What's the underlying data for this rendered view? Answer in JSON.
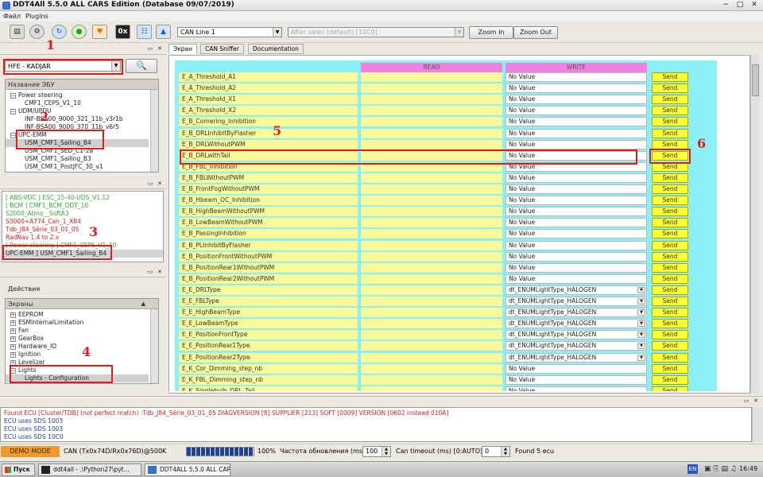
{
  "window": {
    "title": "DDT4All 5.5.0 ALL CARS Edition (Database 09/07/2019)",
    "minimize": "−",
    "maximize": "□",
    "close": "✕"
  },
  "menu": {
    "file": "Файл",
    "plugins": "Plugins"
  },
  "toolbar": {
    "icons": [
      "terminal-icon",
      "chip-icon",
      "refresh-icon",
      "globe-icon",
      "heart-icon",
      "hex-icon",
      "network-icon",
      "valve-icon"
    ],
    "hex_label": "0x",
    "can_line": "CAN Line 1",
    "session": "After sales (default) [10C0]",
    "zoom_in": "Zoom In",
    "zoom_out": "Zoom Out"
  },
  "vehicle": {
    "selected": "HFE - KADJAR",
    "search_icon": "magnifier-icon"
  },
  "ecu_tree": {
    "header": "Название ЭБУ",
    "rows": [
      {
        "text": "Power steering",
        "indent": 1,
        "toggle": "−",
        "selected": false
      },
      {
        "text": "CMF1_CEPS_V1_10",
        "indent": 2,
        "toggle": "",
        "selected": false
      },
      {
        "text": "UDM/UPDU",
        "indent": 1,
        "toggle": "−",
        "selected": false
      },
      {
        "text": "INF-BSA00_9000_321_11b_v3r1b",
        "indent": 2,
        "toggle": "",
        "selected": false
      },
      {
        "text": "INF-BSA00_9000_370_11b_v6r5",
        "indent": 2,
        "toggle": "",
        "selected": false
      },
      {
        "text": "UPC-EMM",
        "indent": 1,
        "toggle": "−",
        "selected": false
      },
      {
        "text": "USM_CMF1_Sailing_B4",
        "indent": 2,
        "toggle": "",
        "selected": true
      },
      {
        "text": "USM_CMF1_SED_C1-2a",
        "indent": 2,
        "toggle": "",
        "selected": false
      },
      {
        "text": "USM_CMF1_Sailing_B3",
        "indent": 2,
        "toggle": "",
        "selected": false
      },
      {
        "text": "USM_CMF1_PostJFC_30_v1",
        "indent": 2,
        "toggle": "",
        "selected": false
      }
    ]
  },
  "found_ecus": [
    {
      "text": "[ ABS-VDC ] ESC_15-40-UDS_V1.12",
      "color": "#33aa33"
    },
    {
      "text": "[ BCM ] CMF1_BCM_DDT_10",
      "color": "#33aa33"
    },
    {
      "text": "S2000_Atmo__SoftA3",
      "color": "#33aa33"
    },
    {
      "text": "S3000+A774_Can_1_X84",
      "color": "#cc2222"
    },
    {
      "text": "Tdb_J84_Série_03_01_05",
      "color": "#cc2222"
    },
    {
      "text": "RadNav 1.4 to 2.x",
      "color": "#cc2222"
    },
    {
      "text": "[ Power steering ] CMF1_CEPS_V1_10",
      "color": "#33aa33"
    },
    {
      "text": "UPC-EMM ] USM_CMF1_Sailing_B4",
      "color": "#222222"
    }
  ],
  "actions": {
    "title": "Действия",
    "header": "Экраны",
    "rows": [
      {
        "text": "EEPROM",
        "indent": 1,
        "toggle": "+",
        "selected": false
      },
      {
        "text": "ESMInternalLimitation",
        "indent": 1,
        "toggle": "+",
        "selected": false
      },
      {
        "text": "Fan",
        "indent": 1,
        "toggle": "+",
        "selected": false
      },
      {
        "text": "GearBox",
        "indent": 1,
        "toggle": "+",
        "selected": false
      },
      {
        "text": "Hardware_IO",
        "indent": 1,
        "toggle": "+",
        "selected": false
      },
      {
        "text": "Ignition",
        "indent": 1,
        "toggle": "+",
        "selected": false
      },
      {
        "text": "Levelizer",
        "indent": 1,
        "toggle": "+",
        "selected": false
      },
      {
        "text": "Lights",
        "indent": 1,
        "toggle": "−",
        "selected": false
      },
      {
        "text": "Lights - Configuration",
        "indent": 2,
        "toggle": "",
        "selected": true
      }
    ]
  },
  "tabs": [
    {
      "label": "Экран",
      "active": true
    },
    {
      "label": "CAN Sniffer",
      "active": false
    },
    {
      "label": "Documentation",
      "active": false
    }
  ],
  "columns": {
    "read": "READ",
    "write": "WRITE"
  },
  "send_label": "Send",
  "params": [
    {
      "name": "E_A_Threshold_A1",
      "write": "No Value",
      "dropdown": false
    },
    {
      "name": "E_A_Threshold_A2",
      "write": "No Value",
      "dropdown": false
    },
    {
      "name": "E_A_Threshold_X1",
      "write": "No Value",
      "dropdown": false
    },
    {
      "name": "E_A_Threshold_X2",
      "write": "No Value",
      "dropdown": false
    },
    {
      "name": "E_B_Cornering_Inhibition",
      "write": "No Value",
      "dropdown": false
    },
    {
      "name": "E_B_DRLInhibitByFlasher",
      "write": "No Value",
      "dropdown": false
    },
    {
      "name": "E_B_DRLWithoutPWM",
      "write": "No Value",
      "dropdown": false
    },
    {
      "name": "E_B_DRLwithTail",
      "write": "No Value",
      "dropdown": false
    },
    {
      "name": "E_B_FBL_Inhibition",
      "write": "No Value",
      "dropdown": false
    },
    {
      "name": "E_B_FBLWithoutPWM",
      "write": "No Value",
      "dropdown": false
    },
    {
      "name": "E_B_FrontFogWithoutPWM",
      "write": "No Value",
      "dropdown": false
    },
    {
      "name": "E_B_Hbeam_OC_Inhibition",
      "write": "No Value",
      "dropdown": false
    },
    {
      "name": "E_B_HighBeamWithoutPWM",
      "write": "No Value",
      "dropdown": false
    },
    {
      "name": "E_B_LowBeamWithoutPWM",
      "write": "No Value",
      "dropdown": false
    },
    {
      "name": "E_B_PassingInhibition",
      "write": "No Value",
      "dropdown": false
    },
    {
      "name": "E_B_PLInhibitByFlasher",
      "write": "No Value",
      "dropdown": false
    },
    {
      "name": "E_B_PositionFrontWithoutPWM",
      "write": "No Value",
      "dropdown": false
    },
    {
      "name": "E_B_PositionRear1WithoutPWM",
      "write": "No Value",
      "dropdown": false
    },
    {
      "name": "E_B_PositionRear2WithoutPWM",
      "write": "No Value",
      "dropdown": false
    },
    {
      "name": "E_E_DRLType",
      "write": "dt_ENUMLightType_HALOGEN",
      "dropdown": true
    },
    {
      "name": "E_E_FBLType",
      "write": "dt_ENUMLightType_HALOGEN",
      "dropdown": true
    },
    {
      "name": "E_E_HighBeamType",
      "write": "dt_ENUMLightType_HALOGEN",
      "dropdown": true
    },
    {
      "name": "E_E_LowBeamType",
      "write": "dt_ENUMLightType_HALOGEN",
      "dropdown": true
    },
    {
      "name": "E_E_PositionFrontType",
      "write": "dt_ENUMLightType_HALOGEN",
      "dropdown": true
    },
    {
      "name": "E_E_PositionRear1Type",
      "write": "dt_ENUMLightType_HALOGEN",
      "dropdown": true
    },
    {
      "name": "E_E_PositionRear2Type",
      "write": "dt_ENUMLightType_HALOGEN",
      "dropdown": true
    },
    {
      "name": "E_K_Cor_Dimming_step_nb",
      "write": "No Value",
      "dropdown": false
    },
    {
      "name": "E_K_FBL_Dimming_step_nb",
      "write": "No Value",
      "dropdown": false
    },
    {
      "name": "E_K_Singlebulb_DRL_Tail",
      "write": "No Value",
      "dropdown": false
    }
  ],
  "log": [
    {
      "text": "Found ECU [Cluster/TDB] (not perfect match) :Tdb_J84_Série_03_01_05 DIAGVERSION [8] SUPPLIER [213] SOFT [0009] VERSION [0602 instead 010A]",
      "color": "#cc2222"
    },
    {
      "text": "ECU uses SDS 1003",
      "color": "#1f3faa"
    },
    {
      "text": "ECU uses SDS 1003",
      "color": "#1f3faa"
    },
    {
      "text": "ECU uses SDS 10C0",
      "color": "#1f3faa"
    }
  ],
  "status": {
    "demo_mode": "DEMO MODE",
    "can_info": "CAN (Tx0x74D/Rx0x76D)@500K",
    "progress_pct": 100,
    "progress_label": "100%",
    "refresh_label": "Частота обновления (ms):",
    "refresh_value": "100",
    "timeout_label": "Can timeout (ms) [0:AUTO] :",
    "timeout_value": "0",
    "found": "Found 5 ecu"
  },
  "taskbar": {
    "start": "Пуск",
    "tasks": [
      "ddt4all - .\\Python27\\pyt...",
      "DDT4ALL 5.5.0 ALL CARS..."
    ],
    "lang": "EN",
    "clock": "16:49"
  },
  "annotations": [
    "1",
    "2",
    "3",
    "4",
    "5",
    "6"
  ]
}
